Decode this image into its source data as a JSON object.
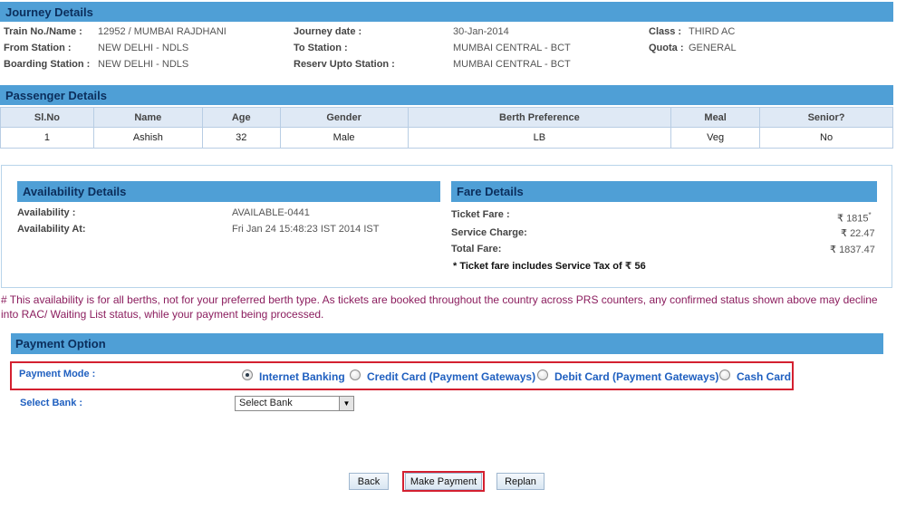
{
  "journey": {
    "header": "Journey Details",
    "train_label": "Train No./Name :",
    "train_value": "12952 / MUMBAI RAJDHANI",
    "from_label": "From Station :",
    "from_value": "NEW DELHI - NDLS",
    "boarding_label": "Boarding Station :",
    "boarding_value": "NEW DELHI - NDLS",
    "date_label": "Journey date :",
    "date_value": "30-Jan-2014",
    "to_label": "To Station :",
    "to_value": "MUMBAI CENTRAL - BCT",
    "reserv_label": "Reserv Upto Station :",
    "reserv_value": "MUMBAI CENTRAL - BCT",
    "class_label": "Class :",
    "class_value": "THIRD AC",
    "quota_label": "Quota :",
    "quota_value": "GENERAL"
  },
  "passenger": {
    "header": "Passenger Details",
    "columns": [
      "Sl.No",
      "Name",
      "Age",
      "Gender",
      "Berth Preference",
      "Meal",
      "Senior?"
    ],
    "rows": [
      [
        "1",
        "Ashish",
        "32",
        "Male",
        "LB",
        "Veg",
        "No"
      ]
    ]
  },
  "availability": {
    "header": "Availability Details",
    "availability_label": "Availability :",
    "availability_value": "AVAILABLE-0441",
    "at_label": "Availability At:",
    "at_value": "Fri Jan 24 15:48:23 IST 2014 IST"
  },
  "fare": {
    "header": "Fare Details",
    "ticket_label": "Ticket Fare :",
    "ticket_value": "1815",
    "ticket_mark": "*",
    "service_label": "Service Charge:",
    "service_value": "22.47",
    "total_label": "Total Fare:",
    "total_value": "1837.47",
    "tax_note_prefix": "* Ticket fare includes Service Tax of",
    "tax_value": "56",
    "currency_symbol": "₹"
  },
  "note": "# This availability is for all berths, not for your preferred berth type. As tickets are booked throughout the country across PRS counters, any confirmed status shown above may decline into RAC/ Waiting List status, while your payment being processed.",
  "payment": {
    "header": "Payment Option",
    "mode_label": "Payment Mode :",
    "options": [
      "Internet Banking",
      "Credit Card (Payment Gateways)",
      "Debit Card (Payment Gateways)",
      "Cash Card"
    ],
    "selected": "Internet Banking",
    "bank_label": "Select Bank :",
    "bank_value": "Select Bank"
  },
  "buttons": {
    "back": "Back",
    "make_payment": "Make Payment",
    "replan": "Replan"
  },
  "colors": {
    "header_bg": "#4f9fd6",
    "header_text": "#0b2e5c",
    "highlight_border": "#d42030",
    "link_blue": "#2060c0",
    "note_text": "#8b1d5e"
  }
}
